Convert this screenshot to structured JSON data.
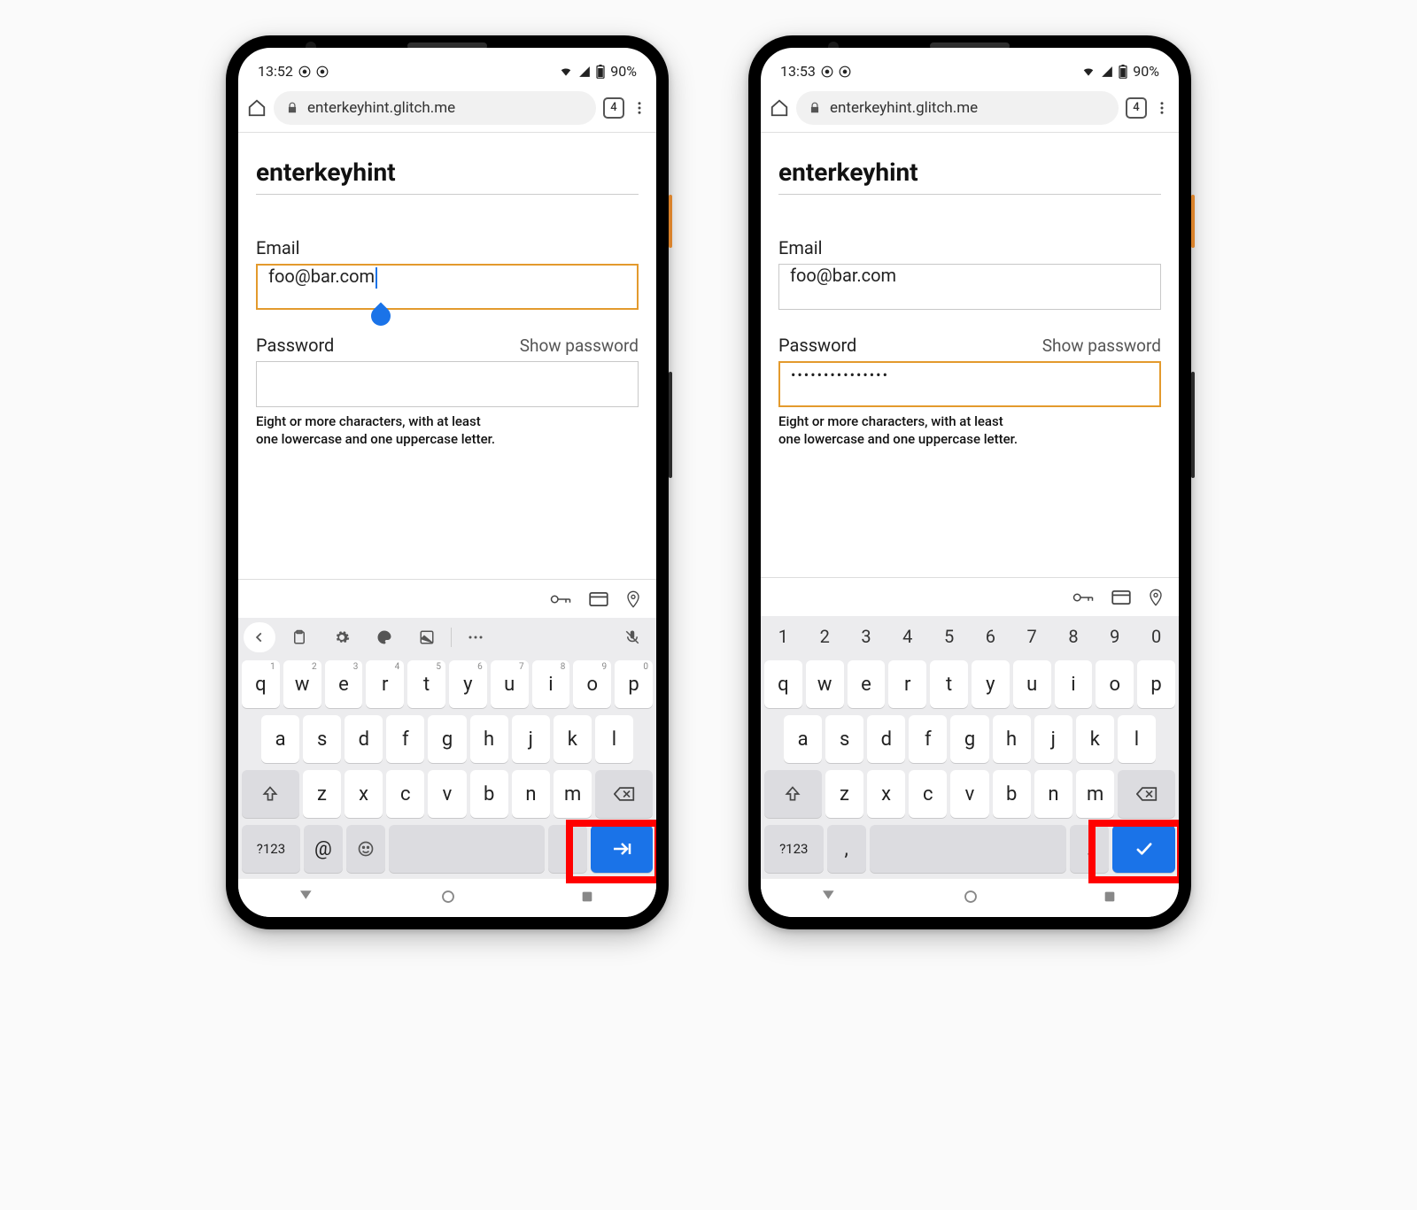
{
  "left": {
    "statusbar": {
      "time": "13:52",
      "battery": "90%"
    },
    "urlbar": {
      "url": "enterkeyhint.glitch.me",
      "tab_count": "4"
    },
    "page": {
      "title": "enterkeyhint",
      "email_label": "Email",
      "email_value": "foo@bar.com",
      "password_label": "Password",
      "show_password": "Show password",
      "password_value": "",
      "hint_line1": "Eight or more characters, with at least",
      "hint_line2": "one lowercase and one uppercase letter."
    },
    "keyboard": {
      "toolbar_icons": [
        "chevron-left",
        "clipboard",
        "gear",
        "palette",
        "sticker",
        "divider",
        "more",
        "mic-off"
      ],
      "row1": [
        {
          "k": "q",
          "s": "1"
        },
        {
          "k": "w",
          "s": "2"
        },
        {
          "k": "e",
          "s": "3"
        },
        {
          "k": "r",
          "s": "4"
        },
        {
          "k": "t",
          "s": "5"
        },
        {
          "k": "y",
          "s": "6"
        },
        {
          "k": "u",
          "s": "7"
        },
        {
          "k": "i",
          "s": "8"
        },
        {
          "k": "o",
          "s": "9"
        },
        {
          "k": "p",
          "s": "0"
        }
      ],
      "row2": [
        "a",
        "s",
        "d",
        "f",
        "g",
        "h",
        "j",
        "k",
        "l"
      ],
      "row3": [
        "z",
        "x",
        "c",
        "v",
        "b",
        "n",
        "m"
      ],
      "sym_key": "?123",
      "at_key": "@",
      "dot_key": ".",
      "enter_kind": "next"
    }
  },
  "right": {
    "statusbar": {
      "time": "13:53",
      "battery": "90%"
    },
    "urlbar": {
      "url": "enterkeyhint.glitch.me",
      "tab_count": "4"
    },
    "page": {
      "title": "enterkeyhint",
      "email_label": "Email",
      "email_value": "foo@bar.com",
      "password_label": "Password",
      "show_password": "Show password",
      "password_value": "•••••••••••••••",
      "hint_line1": "Eight or more characters, with at least",
      "hint_line2": "one lowercase and one uppercase letter."
    },
    "keyboard": {
      "numrow": [
        "1",
        "2",
        "3",
        "4",
        "5",
        "6",
        "7",
        "8",
        "9",
        "0"
      ],
      "row1": [
        {
          "k": "q"
        },
        {
          "k": "w"
        },
        {
          "k": "e"
        },
        {
          "k": "r"
        },
        {
          "k": "t"
        },
        {
          "k": "y"
        },
        {
          "k": "u"
        },
        {
          "k": "i"
        },
        {
          "k": "o"
        },
        {
          "k": "p"
        }
      ],
      "row2": [
        "a",
        "s",
        "d",
        "f",
        "g",
        "h",
        "j",
        "k",
        "l"
      ],
      "row3": [
        "z",
        "x",
        "c",
        "v",
        "b",
        "n",
        "m"
      ],
      "sym_key": "?123",
      "comma_key": ",",
      "dot_key": ".",
      "enter_kind": "done"
    }
  }
}
